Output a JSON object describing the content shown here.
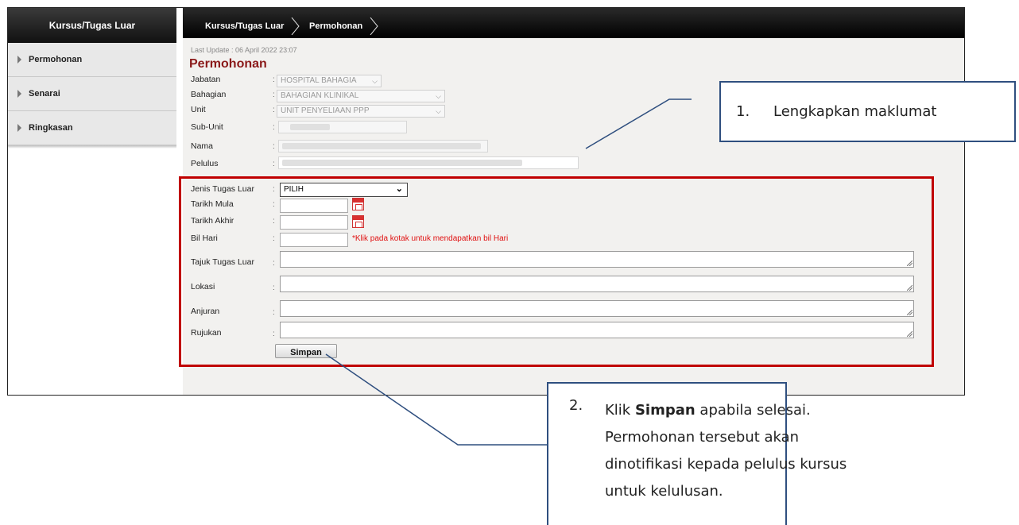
{
  "sidebar": {
    "title": "Kursus/Tugas Luar",
    "items": [
      {
        "label": "Permohonan"
      },
      {
        "label": "Senarai"
      },
      {
        "label": "Ringkasan"
      }
    ]
  },
  "breadcrumb": [
    "Kursus/Tugas Luar",
    "Permohonan"
  ],
  "last_update": "Last Update : 06 April 2022 23:07",
  "page_title": "Permohonan",
  "form": {
    "jabatan": {
      "label": "Jabatan",
      "value": "HOSPITAL BAHAGIA"
    },
    "bahagian": {
      "label": "Bahagian",
      "value": "BAHAGIAN KLINIKAL"
    },
    "unit": {
      "label": "Unit",
      "value": "UNIT PENYELIAAN PPP"
    },
    "sub_unit": {
      "label": "Sub-Unit"
    },
    "nama": {
      "label": "Nama"
    },
    "pelulus": {
      "label": "Pelulus"
    },
    "jenis": {
      "label": "Jenis Tugas Luar",
      "value": "PILIH"
    },
    "tarikh_mula": {
      "label": "Tarikh Mula"
    },
    "tarikh_akhir": {
      "label": "Tarikh Akhir"
    },
    "bil_hari": {
      "label": "Bil Hari",
      "hint": "*Klik pada kotak untuk mendapatkan bil Hari"
    },
    "tajuk": {
      "label": "Tajuk Tugas Luar"
    },
    "lokasi": {
      "label": "Lokasi"
    },
    "anjuran": {
      "label": "Anjuran"
    },
    "rujukan": {
      "label": "Rujukan"
    },
    "colon": ":",
    "save_label": "Simpan"
  },
  "callouts": {
    "one": {
      "number": "1.",
      "text": "Lengkapkan maklumat"
    },
    "two": {
      "number": "2.",
      "line1_pre": "Klik ",
      "line1_bold": "Simpan",
      "line1_post": " apabila selesai.",
      "line2": "Permohonan tersebut akan",
      "line3": "dinotifikasi kepada pelulus kursus",
      "line4": "untuk kelulusan."
    }
  },
  "colors": {
    "highlight": "#c00000",
    "callout_border": "#2f4f7f",
    "title": "#8b1a1a",
    "hint": "#e01010"
  }
}
